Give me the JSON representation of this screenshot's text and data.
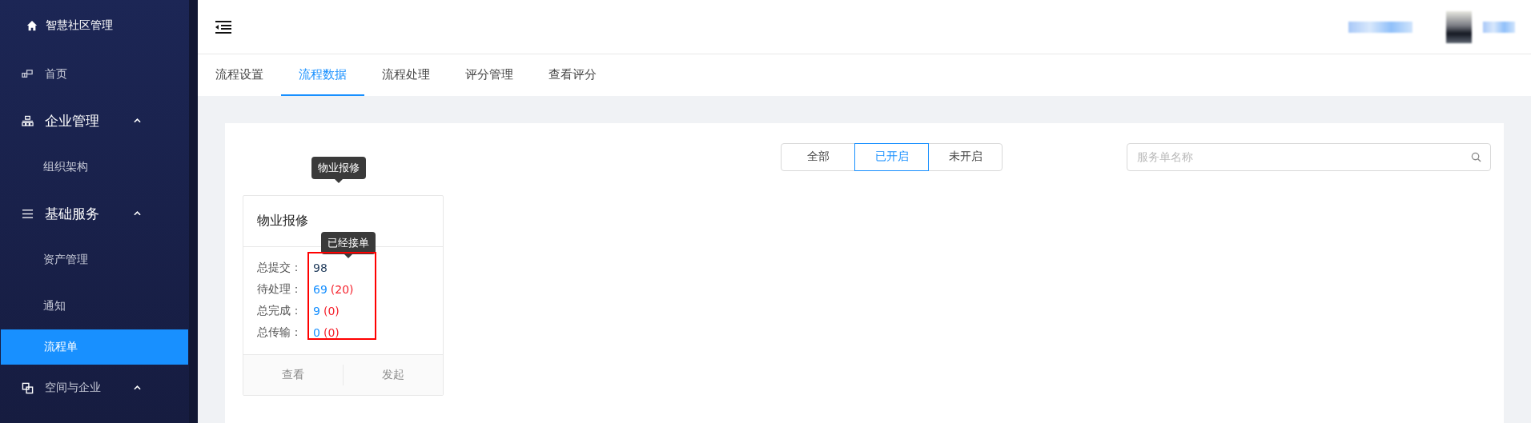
{
  "brand": {
    "title": "智慧社区管理"
  },
  "sidebar": {
    "items": [
      {
        "label": "首页",
        "selected": false
      },
      {
        "label": "企业管理",
        "expanded": true,
        "selected": false,
        "children": [
          {
            "label": "组织架构",
            "selected": false
          }
        ]
      },
      {
        "label": "基础服务",
        "expanded": true,
        "selected": false,
        "children": [
          {
            "label": "资产管理",
            "selected": false
          },
          {
            "label": "通知",
            "selected": false
          },
          {
            "label": "流程单",
            "selected": true
          }
        ]
      },
      {
        "label": "空间与企业",
        "expanded": true,
        "selected": false
      }
    ]
  },
  "tabs": [
    {
      "label": "流程设置",
      "selected": false
    },
    {
      "label": "流程数据",
      "selected": true
    },
    {
      "label": "流程处理",
      "selected": false
    },
    {
      "label": "评分管理",
      "selected": false
    },
    {
      "label": "查看评分",
      "selected": false
    }
  ],
  "filter": [
    {
      "label": "全部",
      "selected": false
    },
    {
      "label": "已开启",
      "selected": true
    },
    {
      "label": "未开启",
      "selected": false
    }
  ],
  "search": {
    "placeholder": "服务单名称"
  },
  "cards": [
    {
      "title": "物业报修",
      "tooltip": "物业报修",
      "stats": [
        {
          "label": "总提交：",
          "value": "98",
          "tooltip": "已经接单"
        },
        {
          "label": "待处理：",
          "value": "69",
          "extra": "(20)"
        },
        {
          "label": "总完成：",
          "value": "9",
          "extra": "(0)"
        },
        {
          "label": "总传输：",
          "value": "0",
          "extra": "(0)"
        }
      ],
      "actions": [
        "查看",
        "发起"
      ]
    }
  ]
}
